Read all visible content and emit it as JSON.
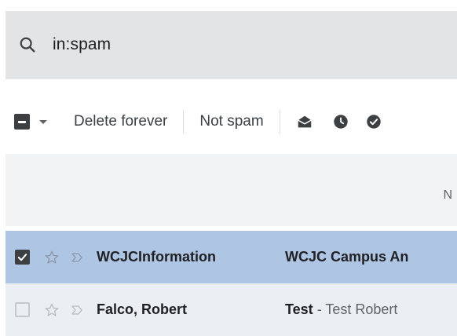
{
  "search": {
    "query": "in:spam"
  },
  "toolbar": {
    "delete_label": "Delete forever",
    "notspam_label": "Not spam"
  },
  "header_band": {
    "partial_text": "N"
  },
  "rows": [
    {
      "checked": true,
      "sender": "WCJCInformation",
      "subject": "WCJC Campus An",
      "snippet": ""
    },
    {
      "checked": false,
      "sender": "Falco, Robert",
      "subject": "Test",
      "snippet": " - Test Robert"
    }
  ],
  "colors": {
    "search_bg": "#e2e4e6",
    "selected_row": "#aec5e4",
    "row_bg": "#eceff1",
    "band_bg": "#f1f3f4"
  }
}
